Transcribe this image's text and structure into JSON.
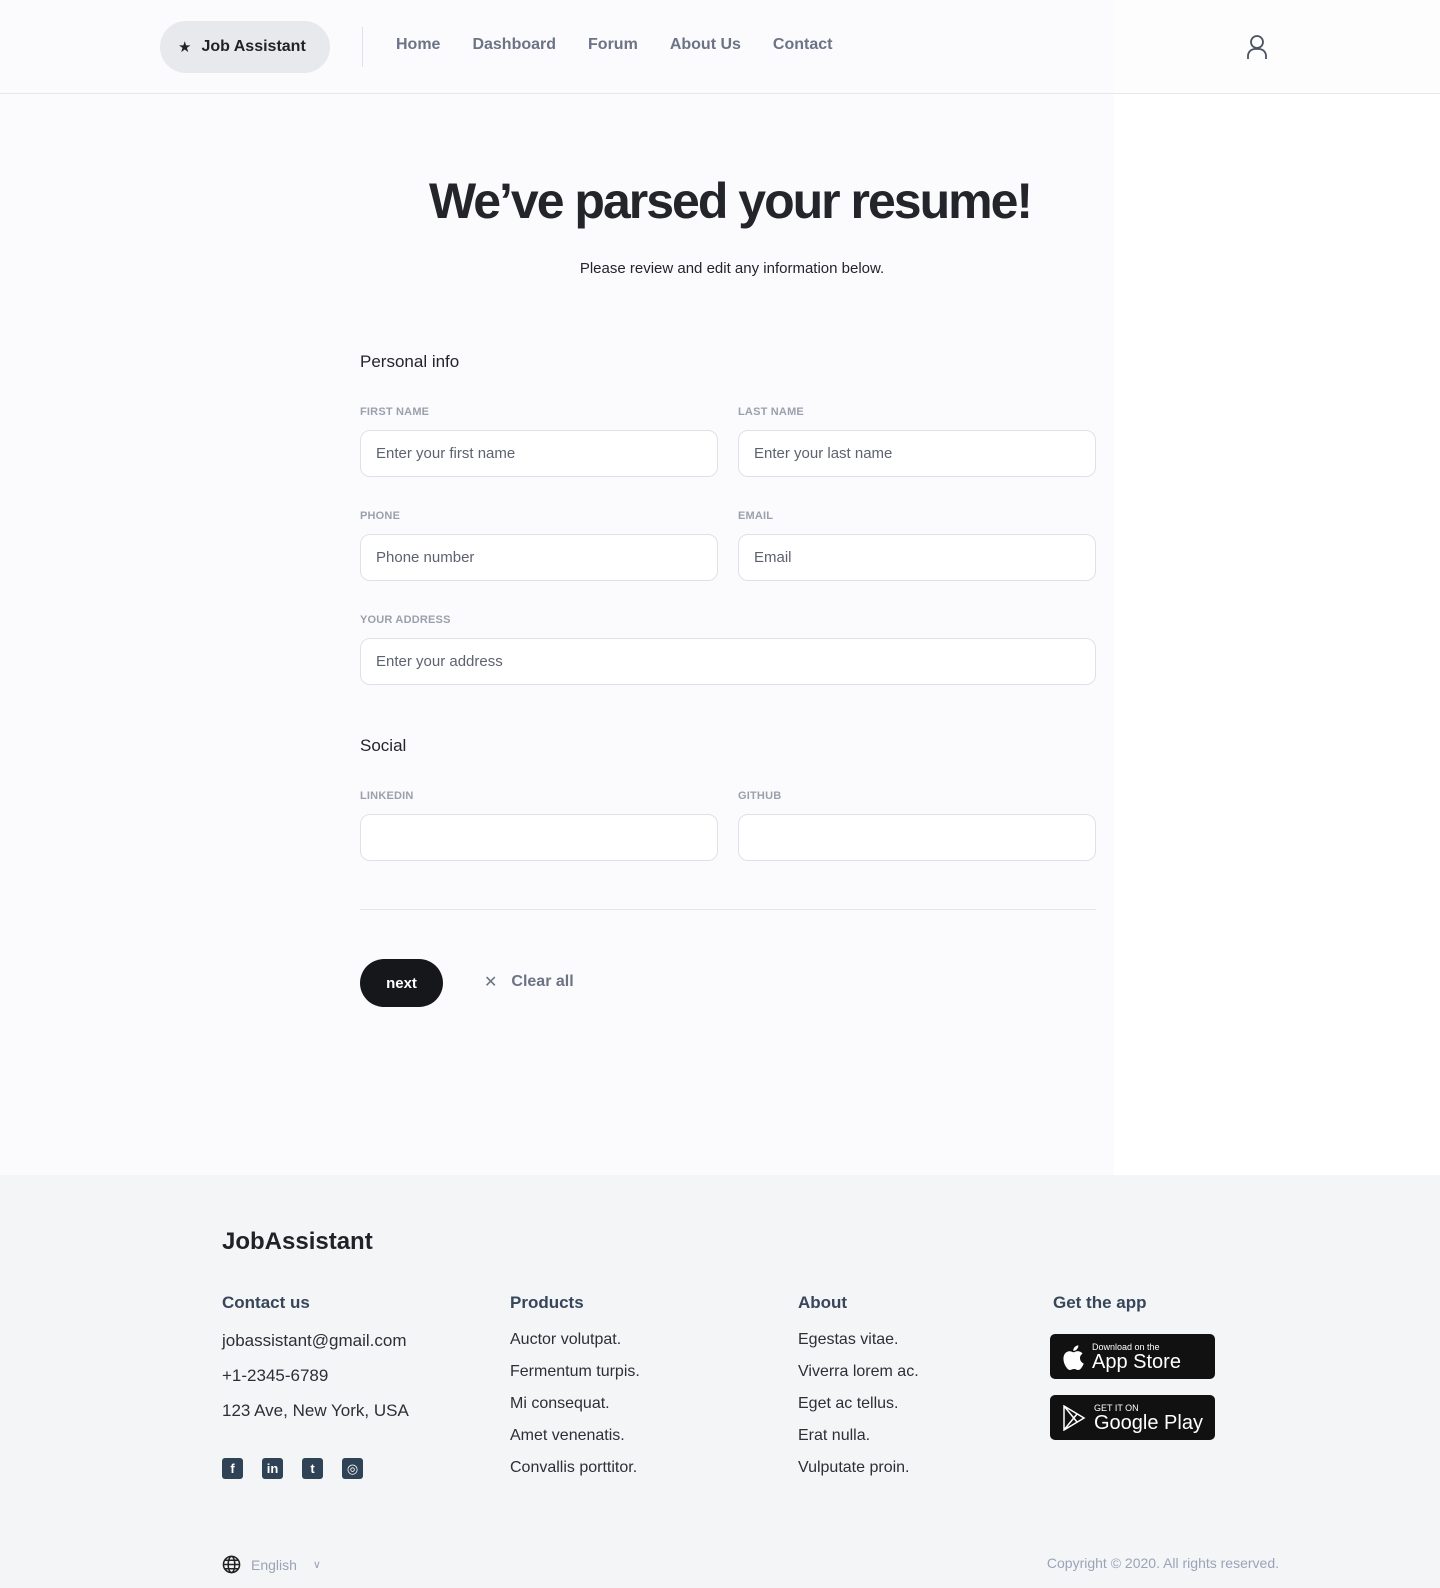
{
  "header": {
    "brand": "Job Assistant",
    "nav": [
      "Home",
      "Dashboard",
      "Forum",
      "About Us",
      "Contact"
    ]
  },
  "main": {
    "title": "We’ve parsed your resume!",
    "subtitle": "Please review and edit any information below.",
    "personal": {
      "heading": "Personal info",
      "first_label": "FIRST NAME",
      "first_ph": "Enter your first name",
      "last_label": "LAST NAME",
      "last_ph": "Enter your last name",
      "phone_label": "PHONE",
      "phone_ph": "Phone number",
      "email_label": "EMAIL",
      "email_ph": "Email",
      "address_label": "YOUR ADDRESS",
      "address_ph": "Enter your address"
    },
    "social": {
      "heading": "Social",
      "linkedin_label": "LINKEDIN",
      "github_label": "GITHUB"
    },
    "next": "next",
    "clear": "Clear all"
  },
  "footer": {
    "logo": "JobAssistant",
    "contact": {
      "title": "Contact us",
      "items": [
        "jobassistant@gmail.com",
        "+1-2345-6789",
        "123 Ave, New York, USA"
      ]
    },
    "products": {
      "title": "Products",
      "items": [
        "Auctor volutpat.",
        "Fermentum turpis.",
        "Mi consequat.",
        "Amet venenatis.",
        "Convallis porttitor."
      ]
    },
    "about": {
      "title": "About",
      "items": [
        "Egestas vitae.",
        "Viverra lorem ac.",
        "Eget ac tellus.",
        "Erat nulla.",
        "Vulputate proin."
      ]
    },
    "app": {
      "title": "Get the app",
      "appstore_small": "Download on the",
      "appstore": "App Store",
      "play_small": "GET IT ON",
      "play": "Google Play"
    },
    "language": "English",
    "copyright": "Copyright © 2020. All rights reserved."
  }
}
